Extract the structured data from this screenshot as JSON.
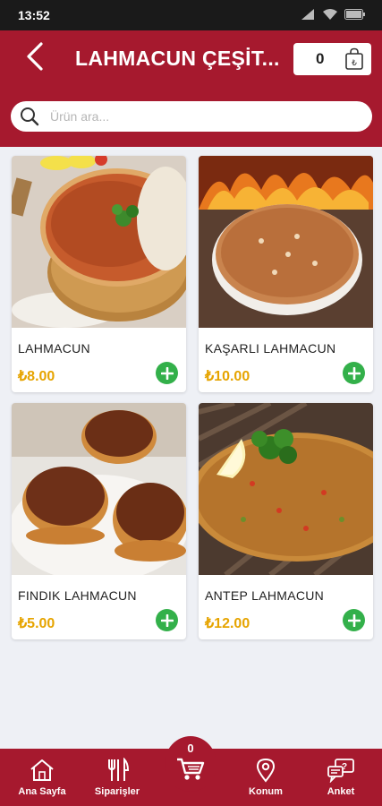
{
  "status_bar": {
    "time": "13:52"
  },
  "header": {
    "title": "LAHMACUN ÇEŞİT...",
    "cart_count": "0"
  },
  "search": {
    "placeholder": "Ürün ara..."
  },
  "products": [
    {
      "name": "LAHMACUN",
      "price": "₺8.00",
      "image": "lahmacun-plate-photo"
    },
    {
      "name": "KAŞARLI LAHMACUN",
      "price": "₺10.00",
      "image": "kasarli-lahmacun-photo"
    },
    {
      "name": "FINDIK LAHMACUN",
      "price": "₺5.00",
      "image": "findik-lahmacun-stack-photo"
    },
    {
      "name": "ANTEP LAHMACUN",
      "price": "₺12.00",
      "image": "antep-lahmacun-photo"
    }
  ],
  "bottom_nav": {
    "items": [
      {
        "label": "Ana Sayfa",
        "icon": "home-icon"
      },
      {
        "label": "Siparişler",
        "icon": "cutlery-icon"
      },
      {
        "label": "Konum",
        "icon": "location-pin-icon"
      },
      {
        "label": "Anket",
        "icon": "survey-chat-icon"
      }
    ],
    "cart_count": "0"
  },
  "colors": {
    "brand": "#a6192e",
    "price": "#e6a400",
    "add": "#33b04a",
    "background": "#eef0f5"
  }
}
